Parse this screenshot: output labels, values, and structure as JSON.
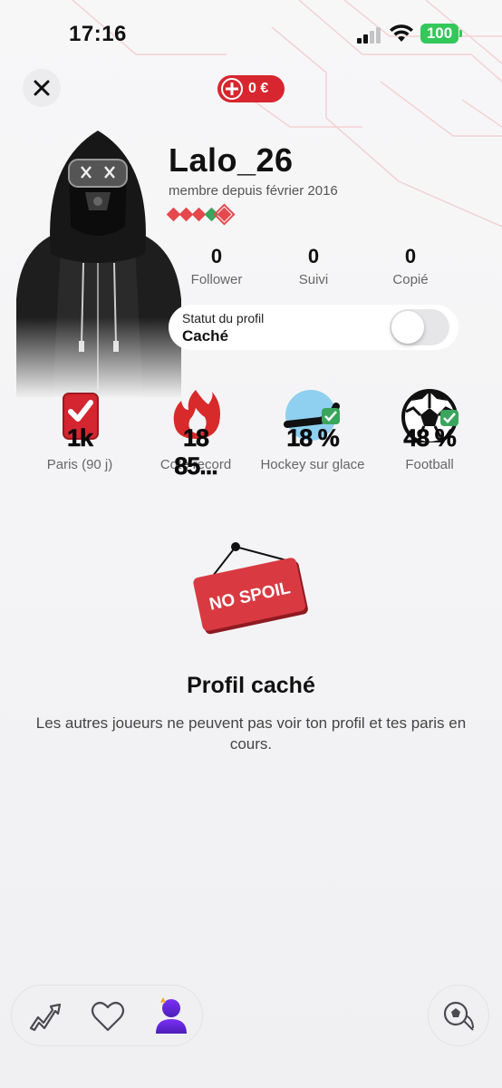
{
  "status_bar": {
    "time": "17:16",
    "battery": "100",
    "battery_color": "#34c759"
  },
  "header": {
    "close_icon": "close-icon",
    "balance": "0 €",
    "balance_color": "#d7262f"
  },
  "profile": {
    "username": "Lalo_26",
    "member_since": "membre depuis février 2016",
    "level_colors": [
      "#e5484d",
      "#e5484d",
      "#e5484d",
      "#3aa55d",
      "#e5484d"
    ],
    "stats": [
      {
        "value": "0",
        "label": "Follower"
      },
      {
        "value": "0",
        "label": "Suivi"
      },
      {
        "value": "0",
        "label": "Copié"
      }
    ],
    "privacy": {
      "label": "Statut du profil",
      "value": "Caché",
      "toggle_on": false
    }
  },
  "badges": [
    {
      "value": "1k",
      "label": "Paris (90 j)",
      "icon": "checkbox-icon"
    },
    {
      "value": "18 85...",
      "label": "Cote record",
      "icon": "flame-icon"
    },
    {
      "value": "18 %",
      "label": "Hockey sur glace",
      "icon": "hockey-stick-icon"
    },
    {
      "value": "48 %",
      "label": "Football",
      "icon": "soccer-ball-icon"
    }
  ],
  "hidden_profile": {
    "sign_text": "NO SPOIL",
    "title": "Profil caché",
    "text": "Les autres joueurs ne peuvent pas voir ton profil et tes paris en cours."
  },
  "bottom_nav": {
    "items": [
      "trend-icon",
      "heart-icon",
      "profile-icon"
    ],
    "fab_icon": "ball-icon"
  }
}
